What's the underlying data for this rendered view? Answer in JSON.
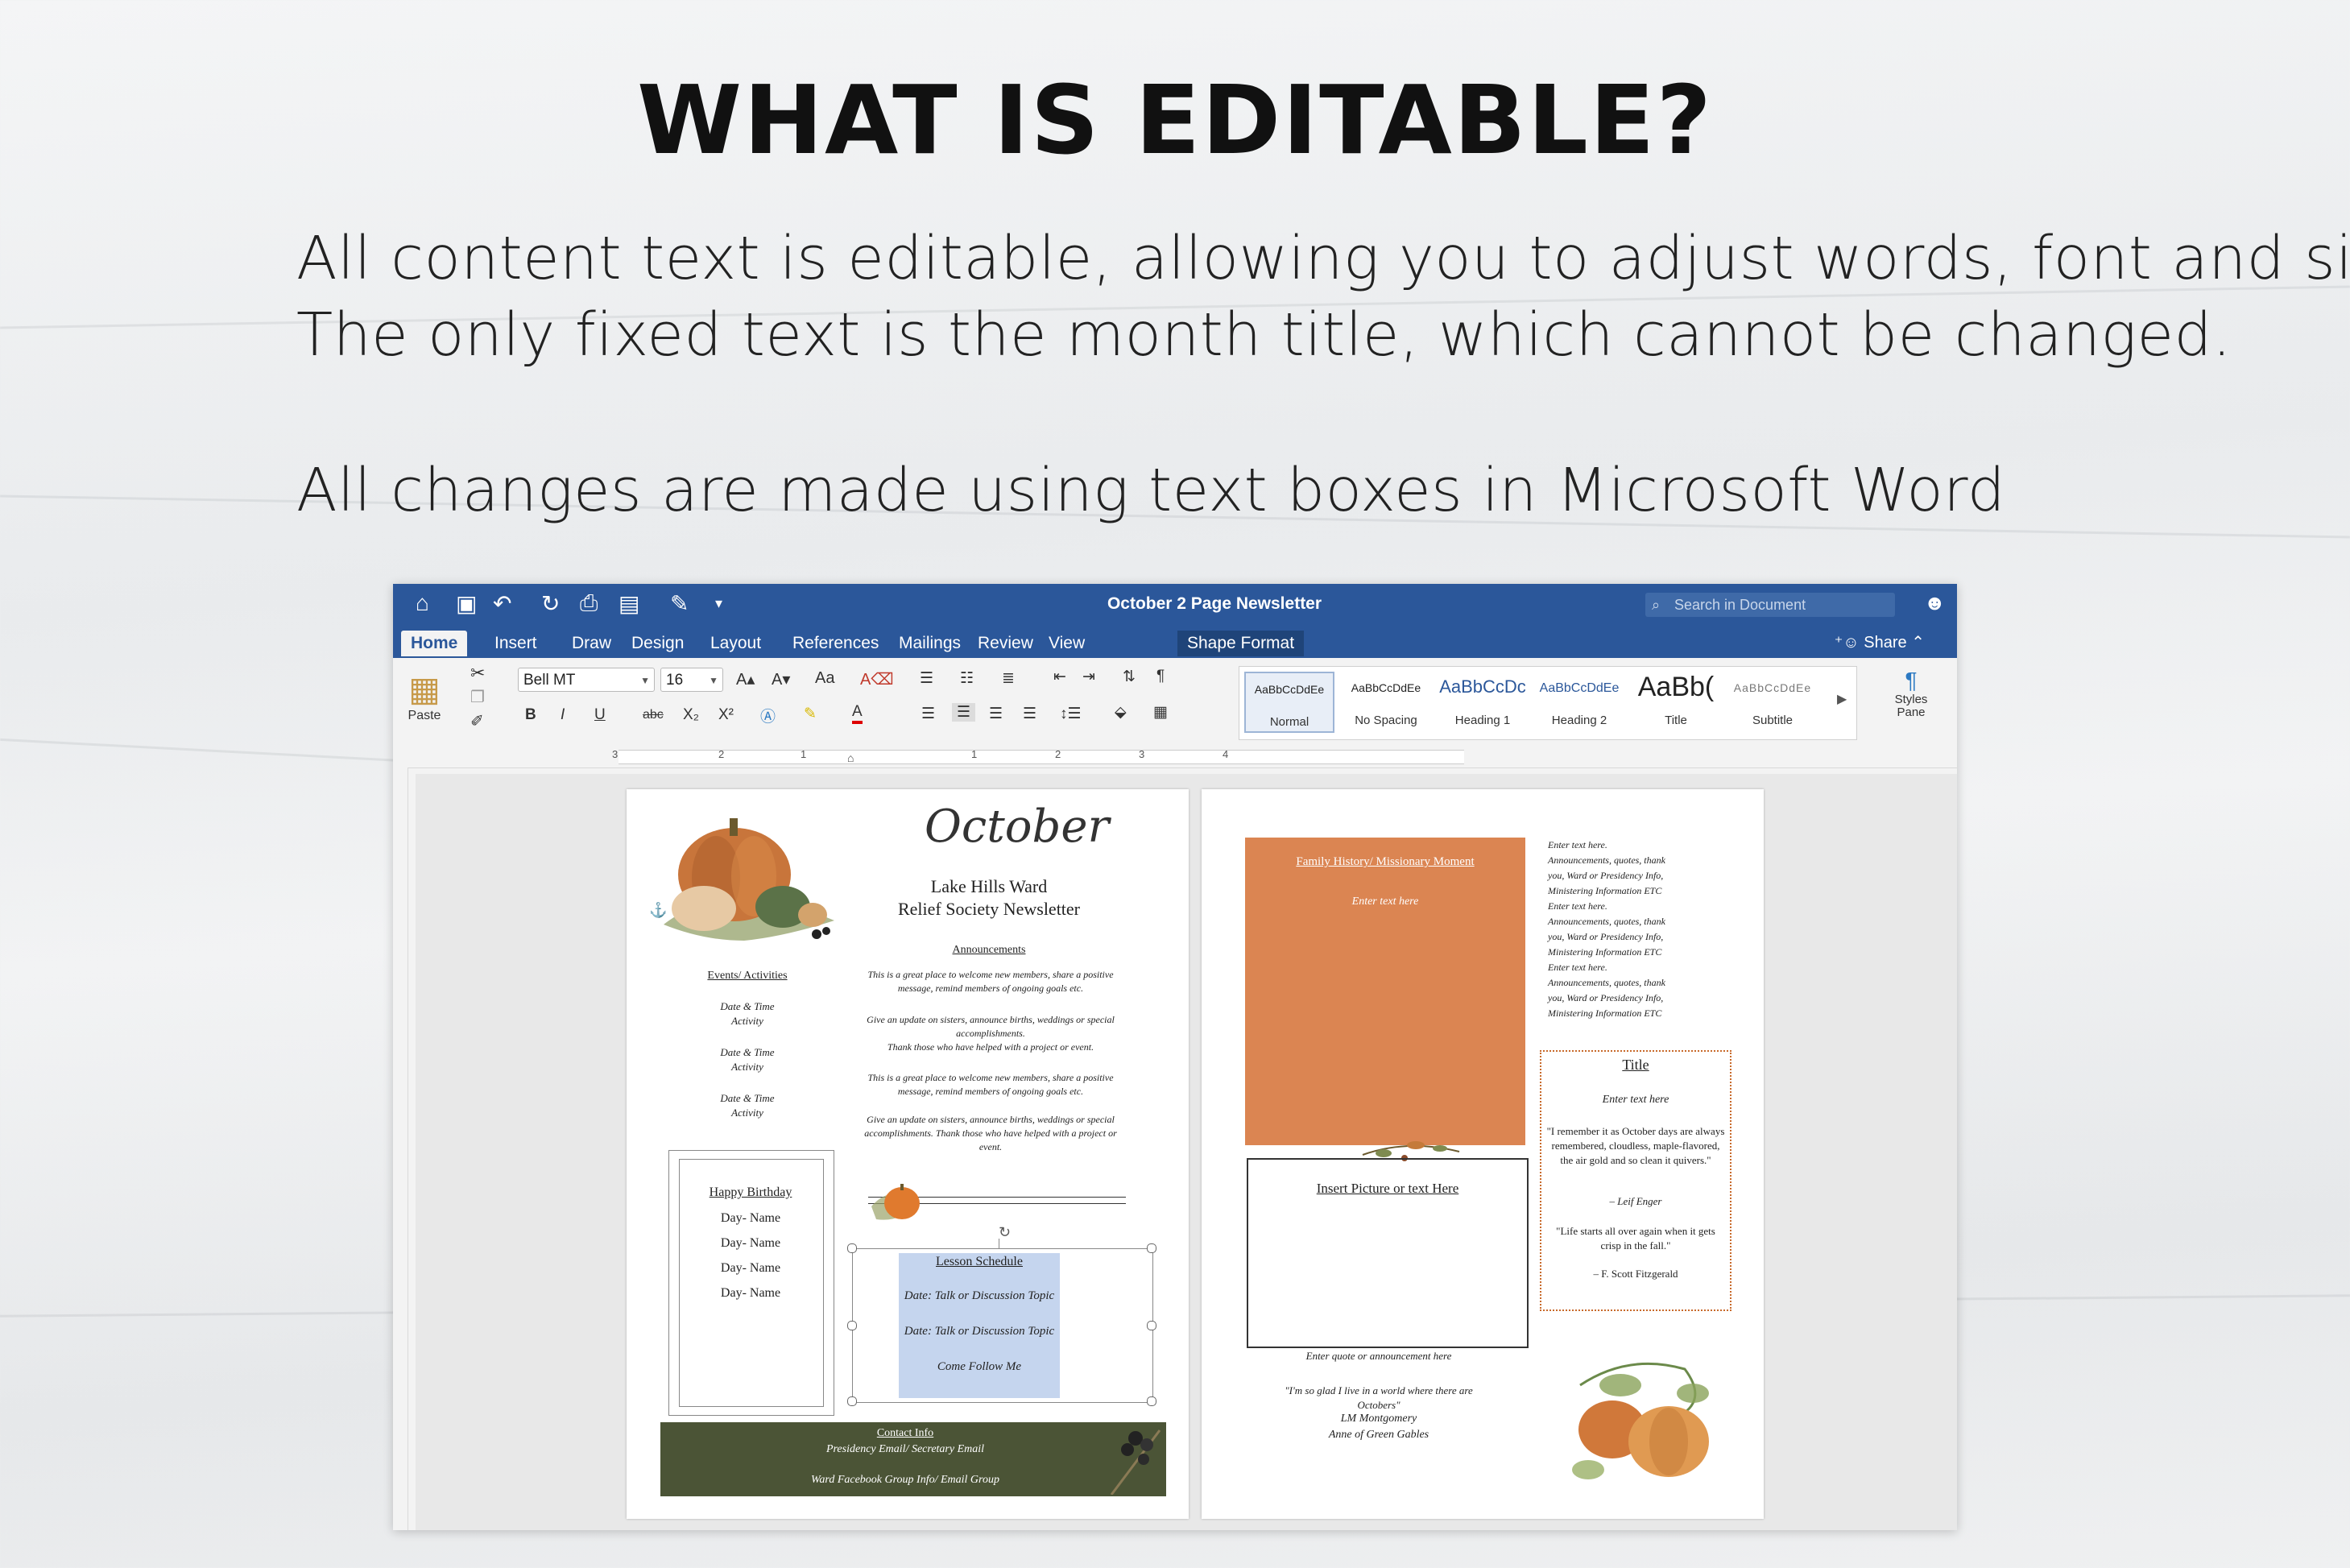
{
  "heading": "WHAT IS EDITABLE?",
  "description": {
    "line1": "All content text is editable, allowing you to adjust words, font and size.",
    "line2": "The only fixed text is the month title, which cannot be changed.",
    "line3": "All changes are made using text boxes in Microsoft Word"
  },
  "word": {
    "document_title": "October 2 Page Newsletter",
    "search_placeholder": "Search in Document",
    "share_label": "Share",
    "tabs": [
      "Home",
      "Insert",
      "Draw",
      "Design",
      "Layout",
      "References",
      "Mailings",
      "Review",
      "View",
      "Shape Format"
    ],
    "ribbon": {
      "paste_label": "Paste",
      "font_name": "Bell MT",
      "font_size": "16",
      "styles": [
        {
          "sample": "AaBbCcDdEe",
          "name": "Normal"
        },
        {
          "sample": "AaBbCcDdEe",
          "name": "No Spacing"
        },
        {
          "sample": "AaBbCcDc",
          "name": "Heading 1"
        },
        {
          "sample": "AaBbCcDdEe",
          "name": "Heading 2"
        },
        {
          "sample": "AaBb(",
          "name": "Title"
        },
        {
          "sample": "AaBbCcDdEe",
          "name": "Subtitle"
        }
      ],
      "styles_pane_label": "Styles Pane"
    },
    "ruler_numbers": [
      "3",
      "2",
      "1",
      "1",
      "2",
      "3",
      "4"
    ]
  },
  "page1": {
    "month_script": "October",
    "ward_name": "Lake Hills Ward",
    "newsletter_name": "Relief Society Newsletter",
    "announcements_heading": "Announcements",
    "announcements": [
      "This is a great place to welcome new members, share a positive message, remind members of ongoing goals etc.",
      "Give an update on sisters, announce births, weddings or special accomplishments.",
      "Thank those who have helped with a project or event.",
      "This is a great place to welcome new members, share a positive message, remind members of ongoing goals etc.",
      "Give an update on sisters, announce births, weddings or special accomplishments. Thank those who have helped with a project or event."
    ],
    "events_heading": "Events/ Activities",
    "events": [
      {
        "date": "Date & Time",
        "activity": "Activity"
      },
      {
        "date": "Date & Time",
        "activity": "Activity"
      },
      {
        "date": "Date & Time",
        "activity": "Activity"
      }
    ],
    "birthday_heading": "Happy Birthday",
    "birthdays": [
      "Day- Name",
      "Day- Name",
      "Day- Name",
      "Day- Name"
    ],
    "lesson_heading": "Lesson Schedule",
    "lessons": [
      "Date: Talk or Discussion Topic",
      "Date: Talk or Discussion Topic",
      "Come Follow Me"
    ],
    "contact_heading": "Contact Info",
    "contact_line1": "Presidency Email/ Secretary Email",
    "contact_line2": "Ward Facebook Group Info/ Email Group"
  },
  "page2": {
    "family_heading": "Family History/ Missionary Moment",
    "family_text": "Enter text here",
    "side_text": "Enter text here. Announcements, quotes, thank you, Ward or Presidency Info, Ministering Information ETC",
    "picture_text": "Insert Picture or text  Here",
    "title_box_heading": "Title",
    "title_box_text": "Enter text here",
    "quote1": "\"I remember it as October days are always remembered, cloudless, maple-flavored, the air gold and so clean it quivers.\"",
    "quote1_author": "– Leif Enger",
    "quote2": "\"Life starts all over again when it gets crisp in the fall.\"",
    "quote2_author": "– F. Scott Fitzgerald",
    "quote_prompt": "Enter quote or announcement here",
    "quote3": "\"I'm so glad I live in a world where there are Octobers\"",
    "quote3_author": "LM Montgomery",
    "quote3_source": "Anne of Green Gables"
  },
  "colors": {
    "word_blue": "#2b579a",
    "orange_box": "#db8552",
    "contact_green": "#4b5436",
    "selection_blue": "#c5d5ee"
  }
}
